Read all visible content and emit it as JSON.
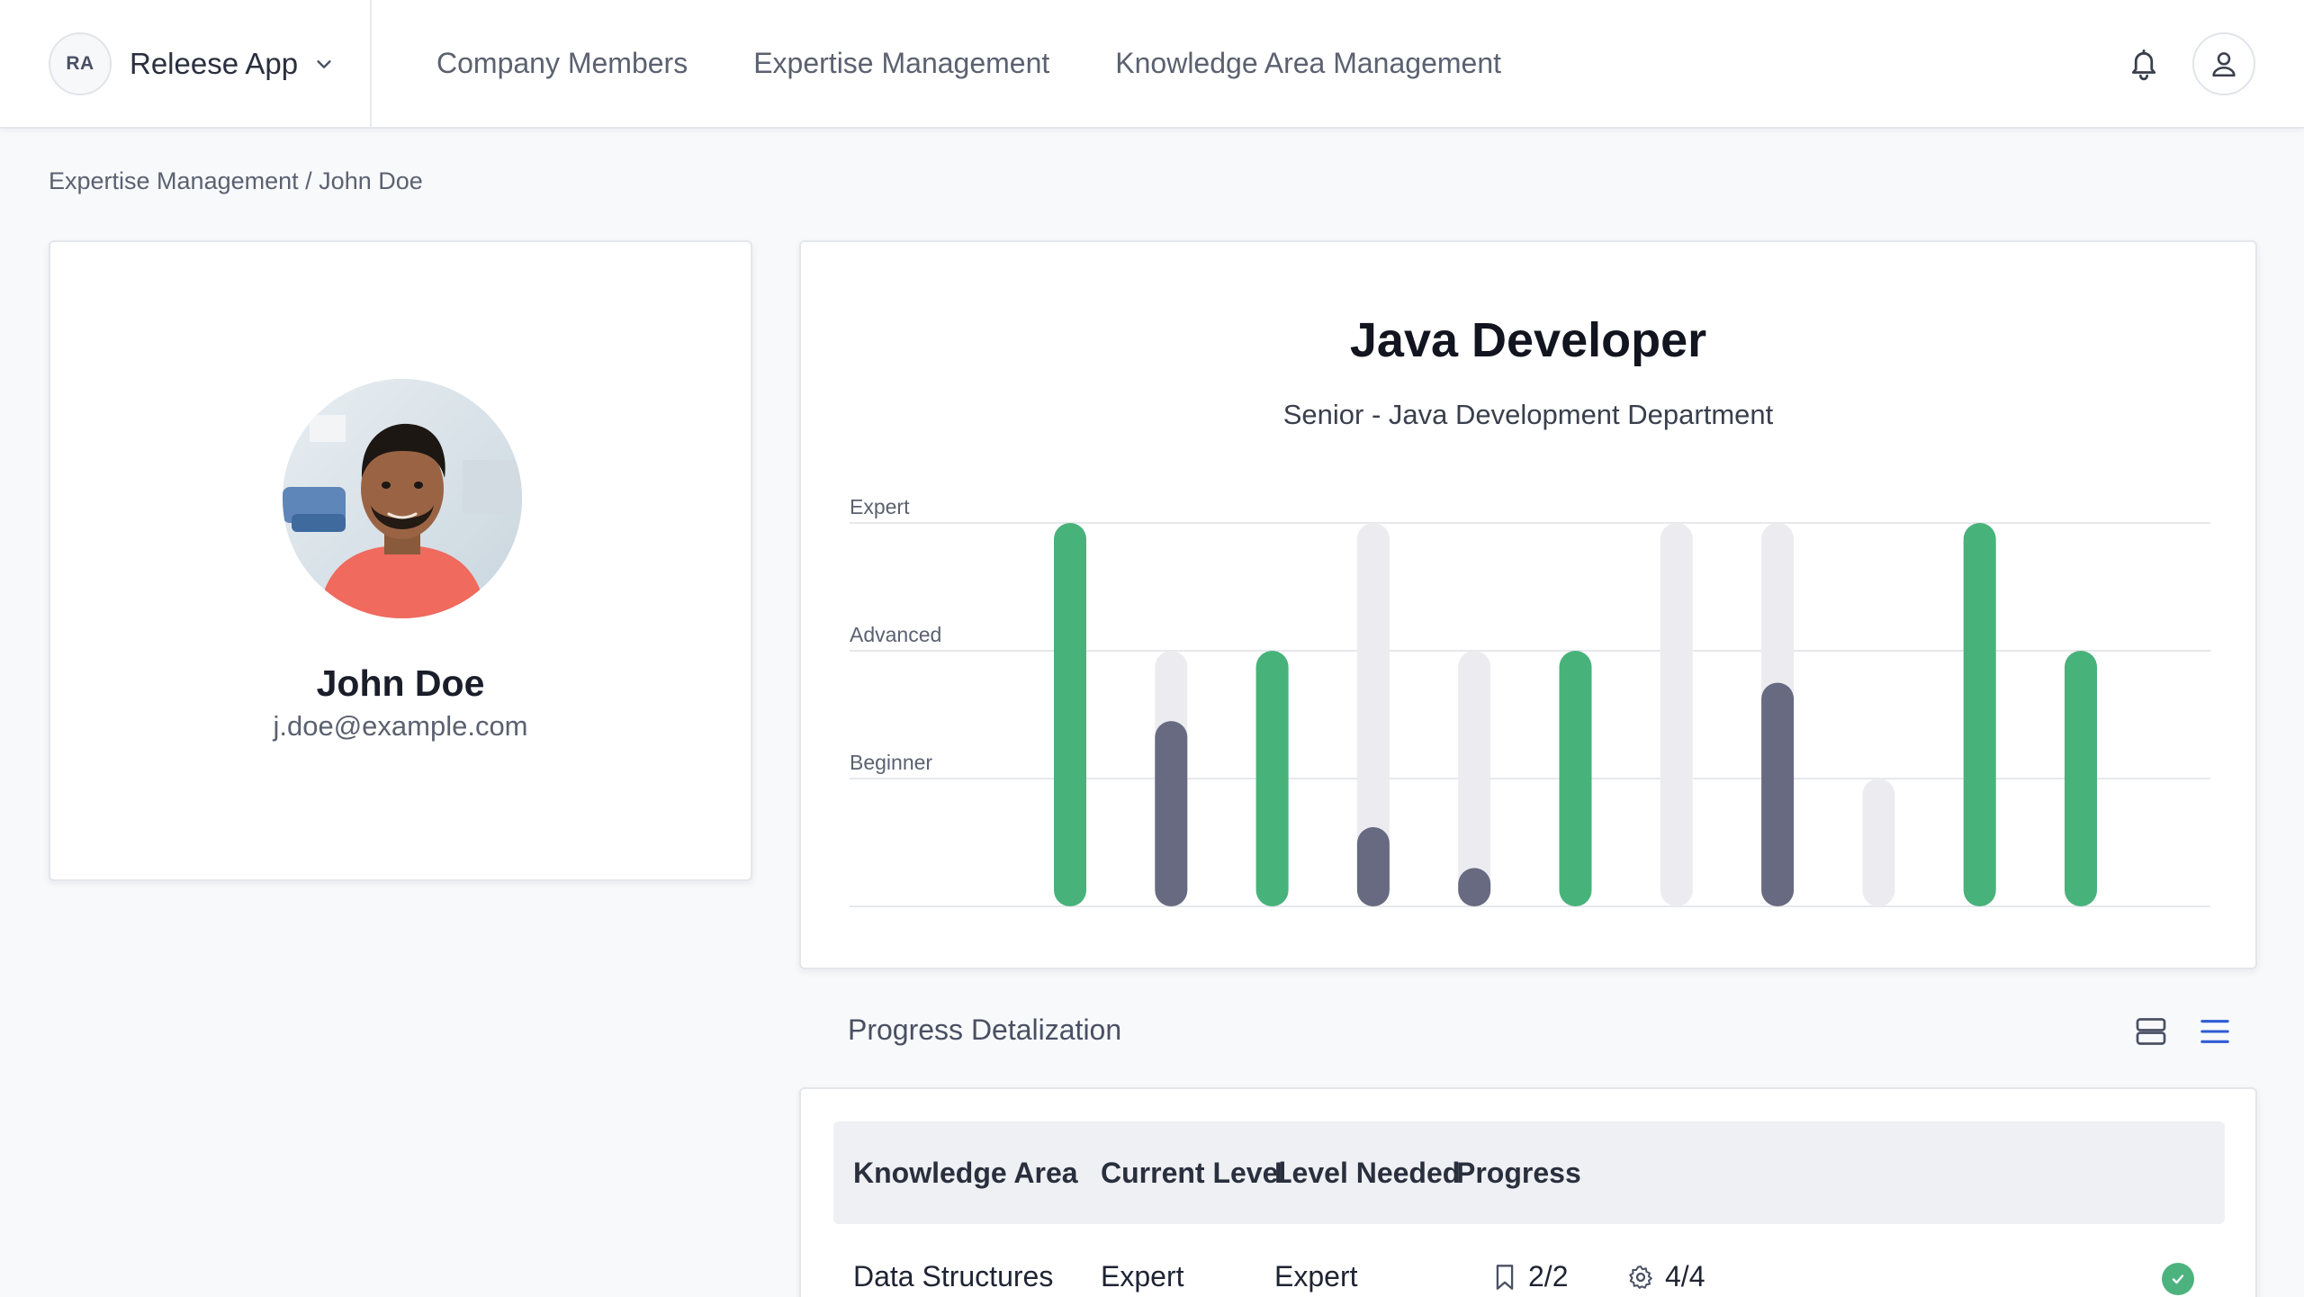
{
  "app": {
    "badge": "RA",
    "name": "Releese App"
  },
  "nav": {
    "items": [
      {
        "label": "Company Members"
      },
      {
        "label": "Expertise Management"
      },
      {
        "label": "Knowledge Area Management"
      }
    ]
  },
  "breadcrumb": {
    "parent": "Expertise Management",
    "separator": " / ",
    "current": "John Doe"
  },
  "profile": {
    "name": "John Doe",
    "email": "j.doe@example.com"
  },
  "role": {
    "title": "Java Developer",
    "subtitle": "Senior - Java Development Department"
  },
  "chart_data": {
    "type": "bar",
    "levels": [
      "Expert",
      "Advanced",
      "Beginner"
    ],
    "scale": {
      "min": 0,
      "max": 3
    },
    "bars": [
      {
        "needed": 3,
        "current": 3
      },
      {
        "needed": 2,
        "current": 1.45
      },
      {
        "needed": 2,
        "current": 2
      },
      {
        "needed": 3,
        "current": 0.62
      },
      {
        "needed": 2,
        "current": 0.3
      },
      {
        "needed": 2,
        "current": 2
      },
      {
        "needed": 3,
        "current": 0
      },
      {
        "needed": 3,
        "current": 1.75
      },
      {
        "needed": 1,
        "current": 0
      },
      {
        "needed": 3,
        "current": 3
      },
      {
        "needed": 2,
        "current": 2
      }
    ],
    "colors": {
      "met": "#48b27b",
      "partial": "#676a80",
      "track": "#ececf0",
      "grid": "#e6e8ec"
    }
  },
  "progress": {
    "title": "Progress Detalization",
    "columns": [
      "Knowledge Area",
      "Current Level",
      "Level Needed",
      "Progress"
    ],
    "rows": [
      {
        "area": "Data Structures",
        "current": "Expert",
        "needed": "Expert",
        "tasks": "2/2",
        "skills": "4/4"
      }
    ]
  }
}
